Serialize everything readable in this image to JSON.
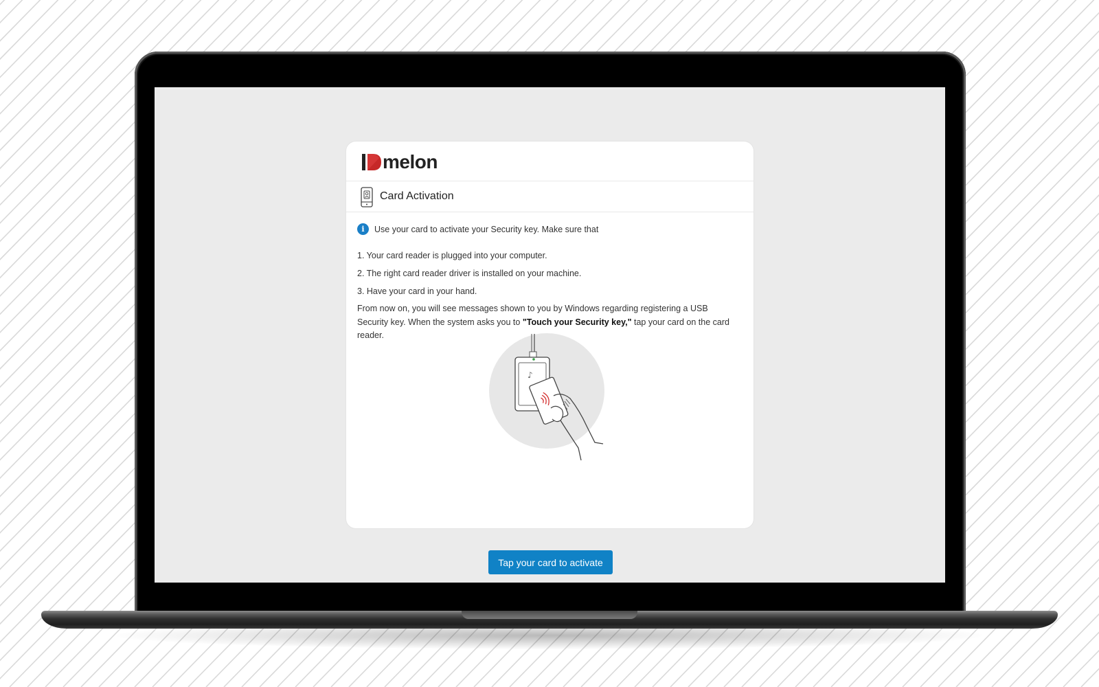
{
  "brand": {
    "logo_text": "melon",
    "logo_mark_letters": "ID",
    "accent_red": "#c62828",
    "primary_blue": "#1082c6"
  },
  "section": {
    "title": "Card Activation",
    "icon": "id-card-icon"
  },
  "info": {
    "icon": "info-icon",
    "text": "Use your card to activate your Security key. Make sure that"
  },
  "steps": [
    "1. Your card reader is plugged into your computer.",
    "2. The right card reader driver is installed on your machine.",
    "3. Have your card in your hand."
  ],
  "instructions": {
    "before": "From now on, you will see messages shown to you by Windows regarding registering a USB Security key. When the system asks you to ",
    "emphasis": "\"Touch your Security key,\"",
    "after": " tap your card on the card reader."
  },
  "illustration": {
    "icon": "hand-tapping-card-on-reader-icon"
  },
  "cta": {
    "label": "Tap your card to activate"
  }
}
